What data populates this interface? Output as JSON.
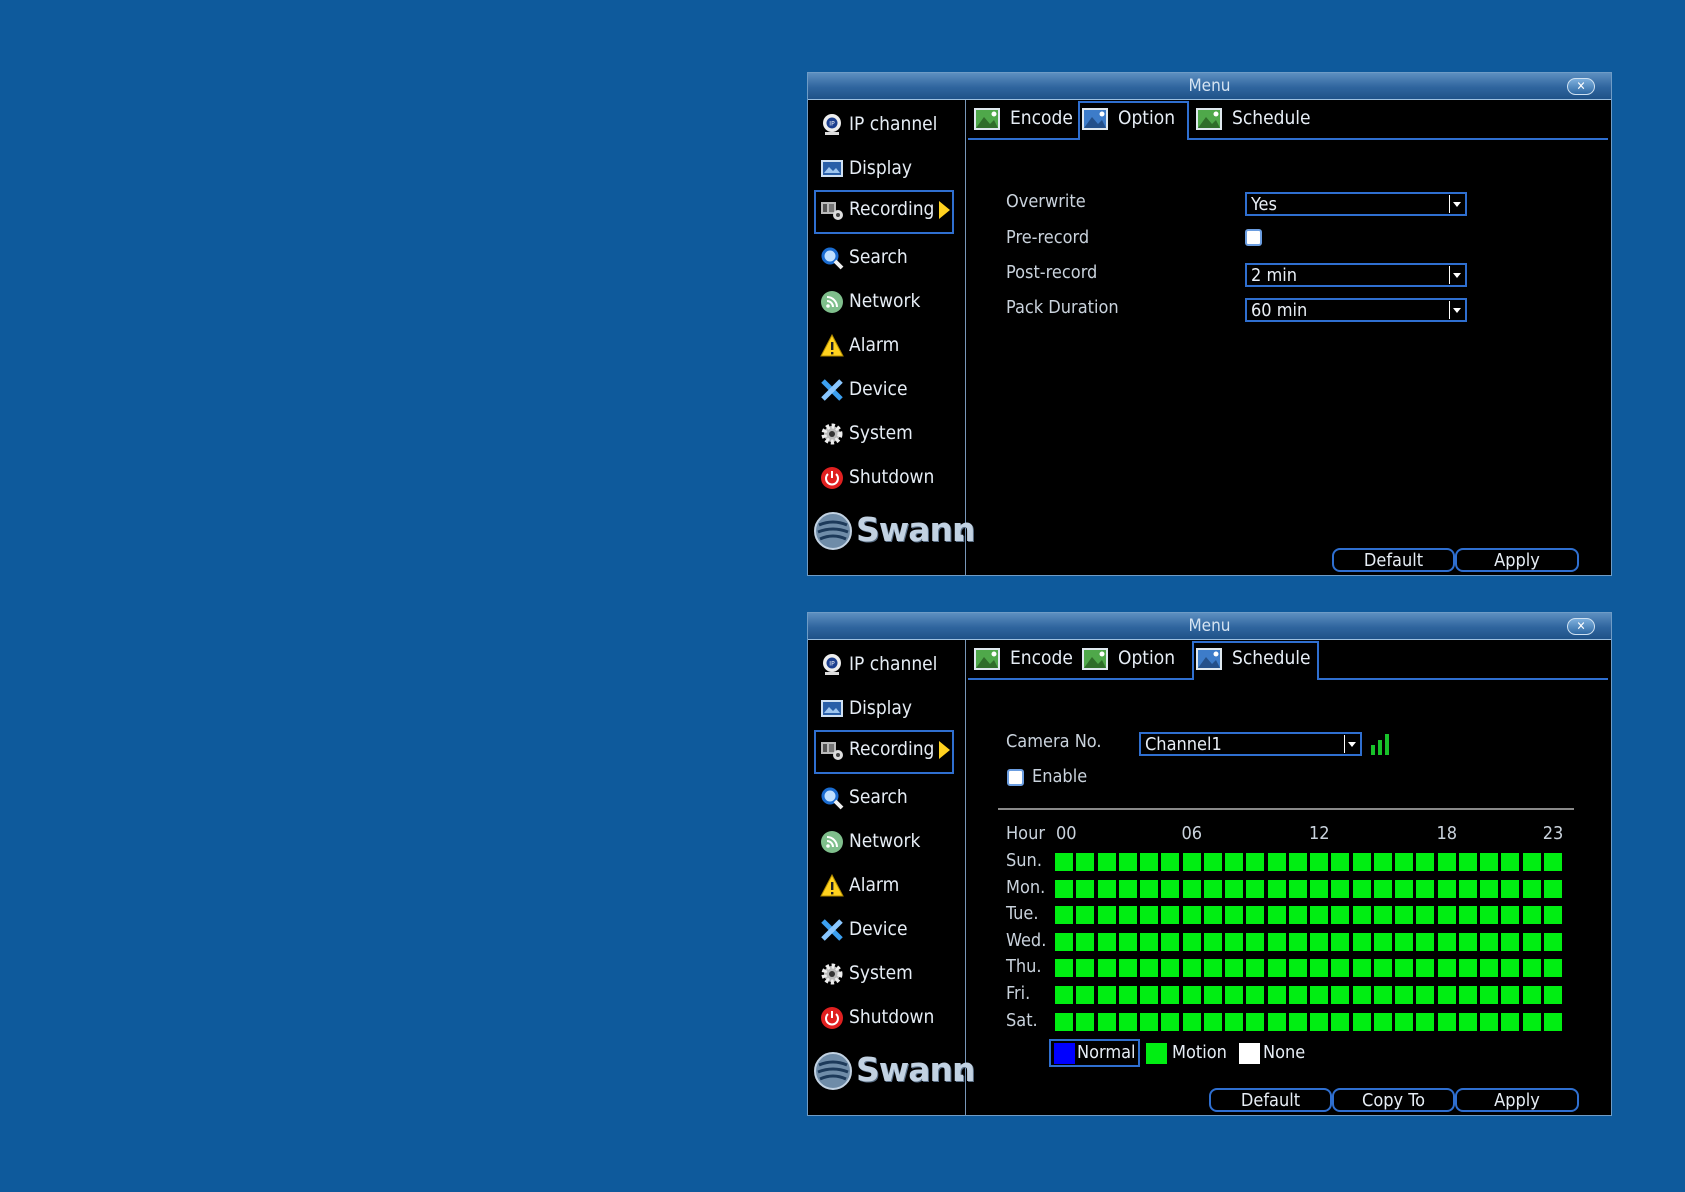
{
  "window_title": "Menu",
  "close_glyph": "✕",
  "sidebar": {
    "items": [
      {
        "label": "IP channel",
        "icon": "ip-camera-icon"
      },
      {
        "label": "Display",
        "icon": "display-icon"
      },
      {
        "label": "Recording",
        "icon": "recording-icon",
        "active": true
      },
      {
        "label": "Search",
        "icon": "search-icon"
      },
      {
        "label": "Network",
        "icon": "network-icon"
      },
      {
        "label": "Alarm",
        "icon": "alarm-icon"
      },
      {
        "label": "Device",
        "icon": "device-icon"
      },
      {
        "label": "System",
        "icon": "system-gear-icon"
      },
      {
        "label": "Shutdown",
        "icon": "power-icon"
      }
    ],
    "brand": "Swann",
    "brand_suffix": "."
  },
  "tabs": [
    "Encode",
    "Option",
    "Schedule"
  ],
  "option_panel": {
    "active_tab": "Option",
    "overwrite_label": "Overwrite",
    "overwrite_value": "Yes",
    "prerecord_label": "Pre-record",
    "prerecord_checked": false,
    "postrecord_label": "Post-record",
    "postrecord_value": "2 min",
    "pack_label": "Pack Duration",
    "pack_value": "60 min",
    "default_label": "Default",
    "apply_label": "Apply"
  },
  "schedule_panel": {
    "active_tab": "Schedule",
    "camera_label": "Camera No.",
    "camera_value": "Channel1",
    "enable_label": "Enable",
    "enable_checked": false,
    "hour_label": "Hour",
    "hour_marks": [
      "00",
      "06",
      "12",
      "18",
      "23"
    ],
    "days": [
      "Sun.",
      "Mon.",
      "Tue.",
      "Wed.",
      "Thu.",
      "Fri.",
      "Sat."
    ],
    "hours_per_day": 24,
    "all_cells_mode": "Motion",
    "legend": [
      {
        "label": "Normal",
        "color": "#0000ff"
      },
      {
        "label": "Motion",
        "color": "#00ee12"
      },
      {
        "label": "None",
        "color": "#ffffff"
      }
    ],
    "default_label": "Default",
    "copy_label": "Copy To",
    "apply_label": "Apply"
  },
  "colors": {
    "background": "#0e5a9c",
    "accent": "#2f6fd0",
    "motion": "#00ee12",
    "active_arrow": "#ffd21f"
  }
}
